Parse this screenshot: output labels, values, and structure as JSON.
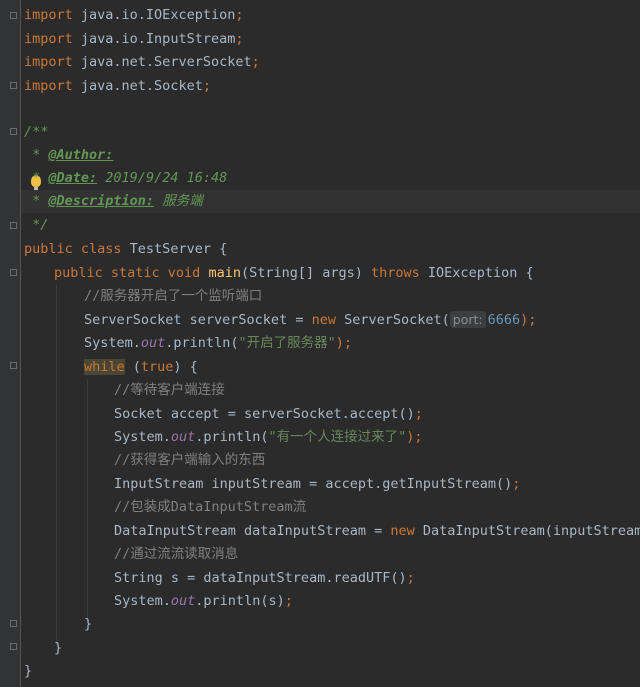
{
  "code": {
    "l1": {
      "kw": "import",
      "rest": " java.io.IOException",
      "semi": ";"
    },
    "l2": {
      "kw": "import",
      "rest": " java.io.InputStream",
      "semi": ";"
    },
    "l3": {
      "kw": "import",
      "rest": " java.net.ServerSocket",
      "semi": ";"
    },
    "l4": {
      "kw": "import",
      "rest": " java.net.Socket",
      "semi": ";"
    },
    "doc_open": "/**",
    "doc_author_prefix": " * ",
    "doc_author_tag": "@Author:",
    "doc_date_prefix": " * ",
    "doc_date_tag": "@Date:",
    "doc_date_value": " 2019/9/24 16:48",
    "doc_desc_prefix": " * ",
    "doc_desc_tag": "@Description:",
    "doc_desc_value": " 服务端",
    "doc_close": " */",
    "class_kw": "public class",
    "class_rest": " TestServer {",
    "main_kw1": "public static void",
    "main_name": "main",
    "main_params": "(String[] args) ",
    "main_throws": "throws",
    "main_rest": " IOException {",
    "c1": "//服务器开启了一个监听端口",
    "ss_type": "ServerSocket serverSocket = ",
    "ss_new": "new",
    "ss_rest": " ServerSocket(",
    "ss_hint": "port:",
    "ss_num": "6666",
    "ss_end": ");",
    "p1_a": "System.",
    "p1_out": "out",
    "p1_b": ".println(",
    "p1_str": "\"开启了服务器\"",
    "p1_end": ");",
    "while_kw": "while",
    "while_mid": " (",
    "while_true": "true",
    "while_end": ") {",
    "c2": "//等待客户端连接",
    "accept_line": "Socket accept = serverSocket.accept()",
    "accept_semi": ";",
    "p2_a": "System.",
    "p2_out": "out",
    "p2_b": ".println(",
    "p2_str": "\"有一个人连接过来了\"",
    "p2_end": ");",
    "c3": "//获得客户端输入的东西",
    "is_line": "InputStream inputStream = accept.getInputStream()",
    "is_semi": ";",
    "c4": "//包装成DataInputStream流",
    "dis_a": "DataInputStream dataInputStream = ",
    "dis_new": "new",
    "dis_b": " DataInputStream(inputStream)",
    "dis_semi": ";",
    "c5": "//通过流流读取消息",
    "str_line": "String s = dataInputStream.readUTF()",
    "str_semi": ";",
    "p3_a": "System.",
    "p3_out": "out",
    "p3_b": ".println(s)",
    "p3_semi": ";",
    "close1": "}",
    "close2": "}",
    "close3": "}"
  }
}
